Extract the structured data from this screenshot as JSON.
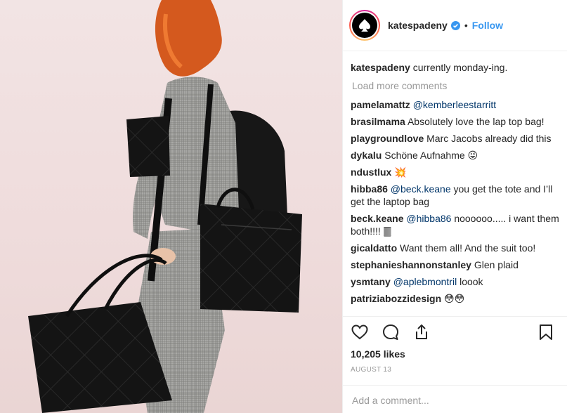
{
  "post": {
    "photo_alt_icon": "fashion-photo",
    "brand_colors": {
      "follow": "#3897f0",
      "mention": "#003569",
      "muted": "#999999"
    }
  },
  "header": {
    "username": "katespadeny",
    "separator": "•",
    "follow_label": "Follow",
    "avatar_icon": "spade-logo-icon",
    "verified_icon": "verified-badge-icon"
  },
  "caption": {
    "user": "katespadeny",
    "text": "currently monday-ing."
  },
  "load_more_label": "Load more comments",
  "comments": [
    {
      "user": "pamelamattz",
      "mention": "@kemberleestarritt",
      "text": ""
    },
    {
      "user": "brasilmama",
      "mention": "",
      "text": "Absolutely love the lap top bag!"
    },
    {
      "user": "playgroundlove",
      "mention": "",
      "text": "Marc Jacobs already did this"
    },
    {
      "user": "dykalu",
      "mention": "",
      "text": "Schöne Aufnahme 😜"
    },
    {
      "user": "ndustlux",
      "mention": "",
      "text": "💥"
    },
    {
      "user": "hibba86",
      "mention": "@beck.keane",
      "text": "you get the tote and I’ll get the laptop bag"
    },
    {
      "user": "beck.keane",
      "mention": "@hibba86",
      "text": "noooooo..... i want them both!!!! 🀫"
    },
    {
      "user": "gicaldatto",
      "mention": "",
      "text": "Want them all! And the suit too!"
    },
    {
      "user": "stephanieshannonstanley",
      "mention": "",
      "text": "Glen plaid"
    },
    {
      "user": "ysmtany",
      "mention": "@aplebmontril",
      "text": "loook"
    },
    {
      "user": "patriziabozzidesign",
      "mention": "",
      "text": "😳😳"
    }
  ],
  "actions": {
    "like_icon": "heart-icon",
    "comment_icon": "comment-icon",
    "share_icon": "share-icon",
    "save_icon": "bookmark-icon"
  },
  "likes_text": "10,205 likes",
  "date_text": "AUGUST 13",
  "add_comment": {
    "placeholder": "Add a comment..."
  }
}
